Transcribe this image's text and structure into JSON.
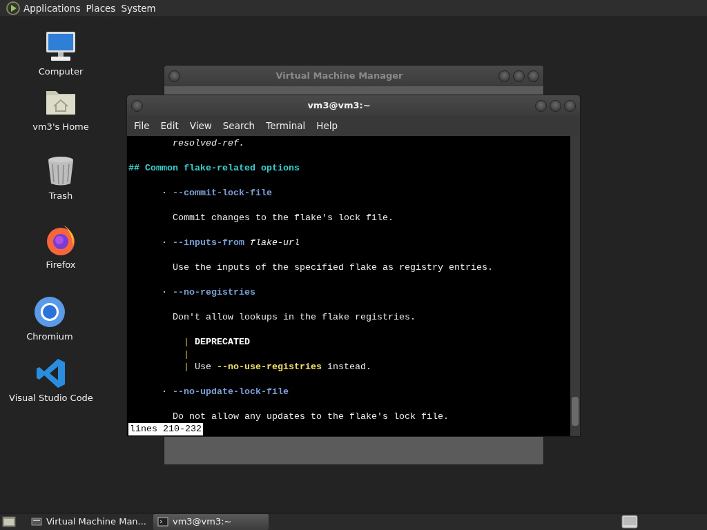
{
  "top_panel": {
    "menus": [
      "Applications",
      "Places",
      "System"
    ]
  },
  "desktop_icons": [
    {
      "label": "Computer",
      "kind": "computer"
    },
    {
      "label": "vm3's Home",
      "kind": "home"
    },
    {
      "label": "Trash",
      "kind": "trash"
    },
    {
      "label": "Firefox",
      "kind": "firefox"
    },
    {
      "label": "Chromium",
      "kind": "chromium"
    },
    {
      "label": "Visual Studio Code",
      "kind": "vscode"
    }
  ],
  "background_window": {
    "title": "Virtual Machine Manager"
  },
  "terminal": {
    "title": "vm3@vm3:~",
    "menu": [
      "File",
      "Edit",
      "View",
      "Search",
      "Terminal",
      "Help"
    ],
    "lines": [
      {
        "kind": "text",
        "segments": [
          {
            "text": "resolved-ref.",
            "kind": "italic"
          }
        ]
      },
      {
        "kind": "blank"
      },
      {
        "kind": "heading",
        "segments": [
          {
            "text": "## Common flake-related options",
            "kind": "heading"
          }
        ]
      },
      {
        "kind": "blank"
      },
      {
        "kind": "bullet",
        "mark": "·",
        "segments": [
          {
            "text": "--commit-lock-file",
            "kind": "option"
          }
        ]
      },
      {
        "kind": "blank"
      },
      {
        "kind": "text",
        "segments": [
          {
            "text": "Commit changes to the flake's lock file.",
            "kind": "plain"
          }
        ]
      },
      {
        "kind": "blank"
      },
      {
        "kind": "bullet",
        "mark": "·",
        "segments": [
          {
            "text": "--inputs-from",
            "kind": "option"
          },
          {
            "text": "flake-url",
            "kind": "italic"
          }
        ]
      },
      {
        "kind": "blank"
      },
      {
        "kind": "text",
        "segments": [
          {
            "text": "Use the inputs of the specified flake as registry entries.",
            "kind": "plain"
          }
        ]
      },
      {
        "kind": "blank"
      },
      {
        "kind": "bullet",
        "mark": "·",
        "segments": [
          {
            "text": "--no-registries",
            "kind": "option"
          }
        ]
      },
      {
        "kind": "blank"
      },
      {
        "kind": "text",
        "segments": [
          {
            "text": "Don't allow lookups in the flake registries.",
            "kind": "plain"
          }
        ]
      },
      {
        "kind": "blank"
      },
      {
        "kind": "quote",
        "mark": "|",
        "segments": [
          {
            "text": "DEPRECATED",
            "kind": "bold"
          }
        ]
      },
      {
        "kind": "quote",
        "mark": "|"
      },
      {
        "kind": "quote",
        "mark": "|",
        "segments": [
          {
            "text": "Use",
            "kind": "plain"
          },
          {
            "text": "--no-use-registries",
            "kind": "literal"
          },
          {
            "text": "instead.",
            "kind": "plain"
          }
        ]
      },
      {
        "kind": "blank"
      },
      {
        "kind": "bullet",
        "mark": "·",
        "segments": [
          {
            "text": "--no-update-lock-file",
            "kind": "option"
          }
        ]
      },
      {
        "kind": "blank"
      },
      {
        "kind": "text",
        "segments": [
          {
            "text": "Do not allow any updates to the flake's lock file.",
            "kind": "plain"
          }
        ]
      }
    ],
    "status": "lines 210-232"
  },
  "taskbar": {
    "tasks": [
      {
        "label": "Virtual Machine Man...",
        "kind": "manager",
        "selected": false
      },
      {
        "label": "vm3@vm3:~",
        "kind": "terminal",
        "selected": true
      }
    ]
  }
}
